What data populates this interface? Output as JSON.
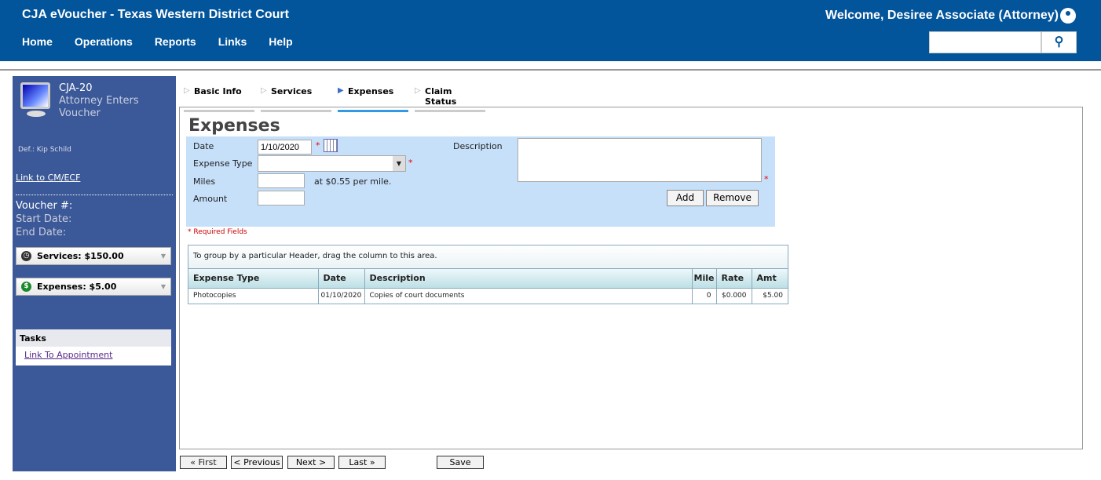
{
  "header": {
    "title": "CJA eVoucher - Texas Western District Court",
    "welcome": "Welcome, Desiree Associate (Attorney)",
    "nav": [
      "Home",
      "Operations",
      "Reports",
      "Links",
      "Help"
    ],
    "search_placeholder": ""
  },
  "sidebar": {
    "form_code": "CJA-20",
    "form_desc1": "Attorney Enters",
    "form_desc2": "Voucher",
    "defendant": "Def.: Kip Schild",
    "cmecf_link": "Link to CM/ECF",
    "voucher_label": "Voucher #:",
    "start_label": "Start Date:",
    "end_label": "End Date:",
    "services": "Services: $150.00",
    "expenses": "Expenses: $5.00",
    "tasks_title": "Tasks",
    "tasks": [
      "Link To Appointment"
    ]
  },
  "tabs": [
    "Basic Info",
    "Services",
    "Expenses",
    "Claim Status"
  ],
  "page_title": "Expenses",
  "form": {
    "date_label": "Date",
    "date_value": "1/10/2020",
    "type_label": "Expense Type",
    "type_value": "",
    "miles_label": "Miles",
    "miles_value": "",
    "rate_text": "at $0.55 per mile.",
    "amount_label": "Amount",
    "amount_value": "",
    "desc_label": "Description",
    "desc_value": "",
    "req": "*",
    "add": "Add",
    "remove": "Remove",
    "required_note": "* Required Fields"
  },
  "grid": {
    "group_hint": "To group by a particular Header, drag the column to this area.",
    "columns": [
      "Expense Type",
      "Date",
      "Description",
      "Mile",
      "Rate",
      "Amt"
    ],
    "rows": [
      [
        "Photocopies",
        "01/10/2020",
        "Copies of court documents",
        "0",
        "$0.000",
        "$5.00"
      ]
    ]
  },
  "pager": {
    "first": "« First",
    "previous": "< Previous",
    "next": "Next >",
    "last": "Last »",
    "save": "Save"
  }
}
